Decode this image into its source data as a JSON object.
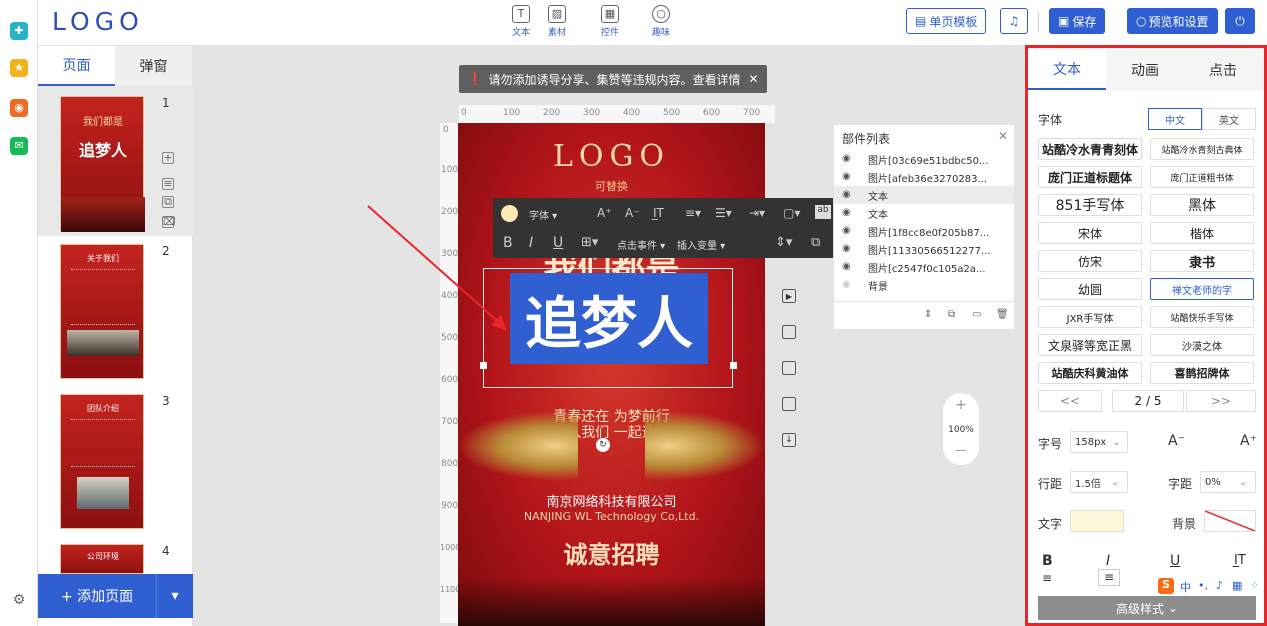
{
  "rail": {
    "settings_icon": "gear-icon"
  },
  "header": {
    "logo": "LOGO",
    "tools": [
      "文本",
      "素材",
      "控件",
      "趣味"
    ],
    "single_template": "单页模板",
    "save": "保存",
    "preview": "预览和设置"
  },
  "pages": {
    "tab_pages": "页面",
    "tab_popup": "弹窗",
    "numbers": [
      "1",
      "2",
      "3",
      "4"
    ],
    "thumb1_title": "追梦人",
    "thumb1_sub": "我们都是",
    "thumb2_title": "关于我们",
    "thumb3_title": "团队介绍",
    "thumb4_title": "公司环境",
    "add_page": "+ 添加页面"
  },
  "canvas": {
    "notice": "请勿添加诱导分享、集赞等违规内容。查看详情",
    "ruler_h": [
      "0",
      "100",
      "200",
      "300",
      "400",
      "500",
      "600",
      "700"
    ],
    "ruler_v": [
      "0",
      "100",
      "200",
      "300",
      "400",
      "500",
      "600",
      "700",
      "800",
      "900",
      "1000",
      "1100"
    ]
  },
  "poster": {
    "logo": "LOGO",
    "replace": "可替换",
    "line1": "我们都是",
    "headline": "追梦人",
    "sub1": "青春还在  为梦前行",
    "sub2": "加入我们  一起追梦",
    "company_cn": "南京网络科技有限公司",
    "company_en": "NANJING WL Technology Co,Ltd.",
    "recruit": "诚意招聘"
  },
  "toolbar": {
    "font": "字体",
    "click_event": "点击事件",
    "insert_var": "插入变量"
  },
  "parts": {
    "title": "部件列表",
    "items": [
      "图片[03c69e51bdbc50...",
      "图片[afeb36e3270283...",
      "文本",
      "文本",
      "图片[1f8cc8e0f205b87...",
      "图片[11330566512277...",
      "图片[c2547f0c105a2a...",
      "背景"
    ]
  },
  "zoom": {
    "plus": "+",
    "value": "100%",
    "minus": "—"
  },
  "panel": {
    "tabs": [
      "文本",
      "动画",
      "点击"
    ],
    "font_label": "字体",
    "lang_cn": "中文",
    "lang_en": "英文",
    "fonts": [
      "站酷冷水青青刻体",
      "站酷冷水青刻古典体",
      "庞门正道标题体",
      "庞门正道粗书体",
      "851手写体",
      "黑体",
      "宋体",
      "楷体",
      "仿宋",
      "隶书",
      "幼圆",
      "禅文老师的字",
      "JXR手写体",
      "站酷快乐手写体",
      "文泉驿等宽正黑",
      "沙漠之体",
      "站酷庆科黄油体",
      "喜鹊招牌体"
    ],
    "pager": {
      "prev": "<<",
      "page": "2 / 5",
      "next": ">>"
    },
    "size_label": "字号",
    "size_value": "158px",
    "line_label": "行距",
    "line_value": "1.5倍",
    "spacing_label": "字距",
    "spacing_value": "0%",
    "text_color_label": "文字",
    "bg_label": "背景",
    "advanced": "高级样式"
  },
  "colors": {
    "accent": "#2f5fd0",
    "highlight": "#e8262a",
    "poster_red": "#b2141a"
  }
}
